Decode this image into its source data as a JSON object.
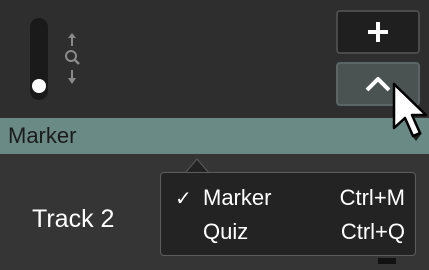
{
  "timeline": {
    "zoom_level": 0.08,
    "marker_track_label": "Marker",
    "track_label": "Track 2"
  },
  "menu": {
    "items": [
      {
        "label": "Marker",
        "shortcut": "Ctrl+M",
        "checked": true
      },
      {
        "label": "Quiz",
        "shortcut": "Ctrl+Q",
        "checked": false
      }
    ]
  },
  "icons": {
    "add": "plus-icon",
    "collapse": "chevron-up-icon",
    "zoom": "zoom-magnifier-icon",
    "cursor": "mouse-pointer-icon"
  },
  "colors": {
    "marker_bar": "#6a8a86",
    "menu_background": "#232323"
  }
}
